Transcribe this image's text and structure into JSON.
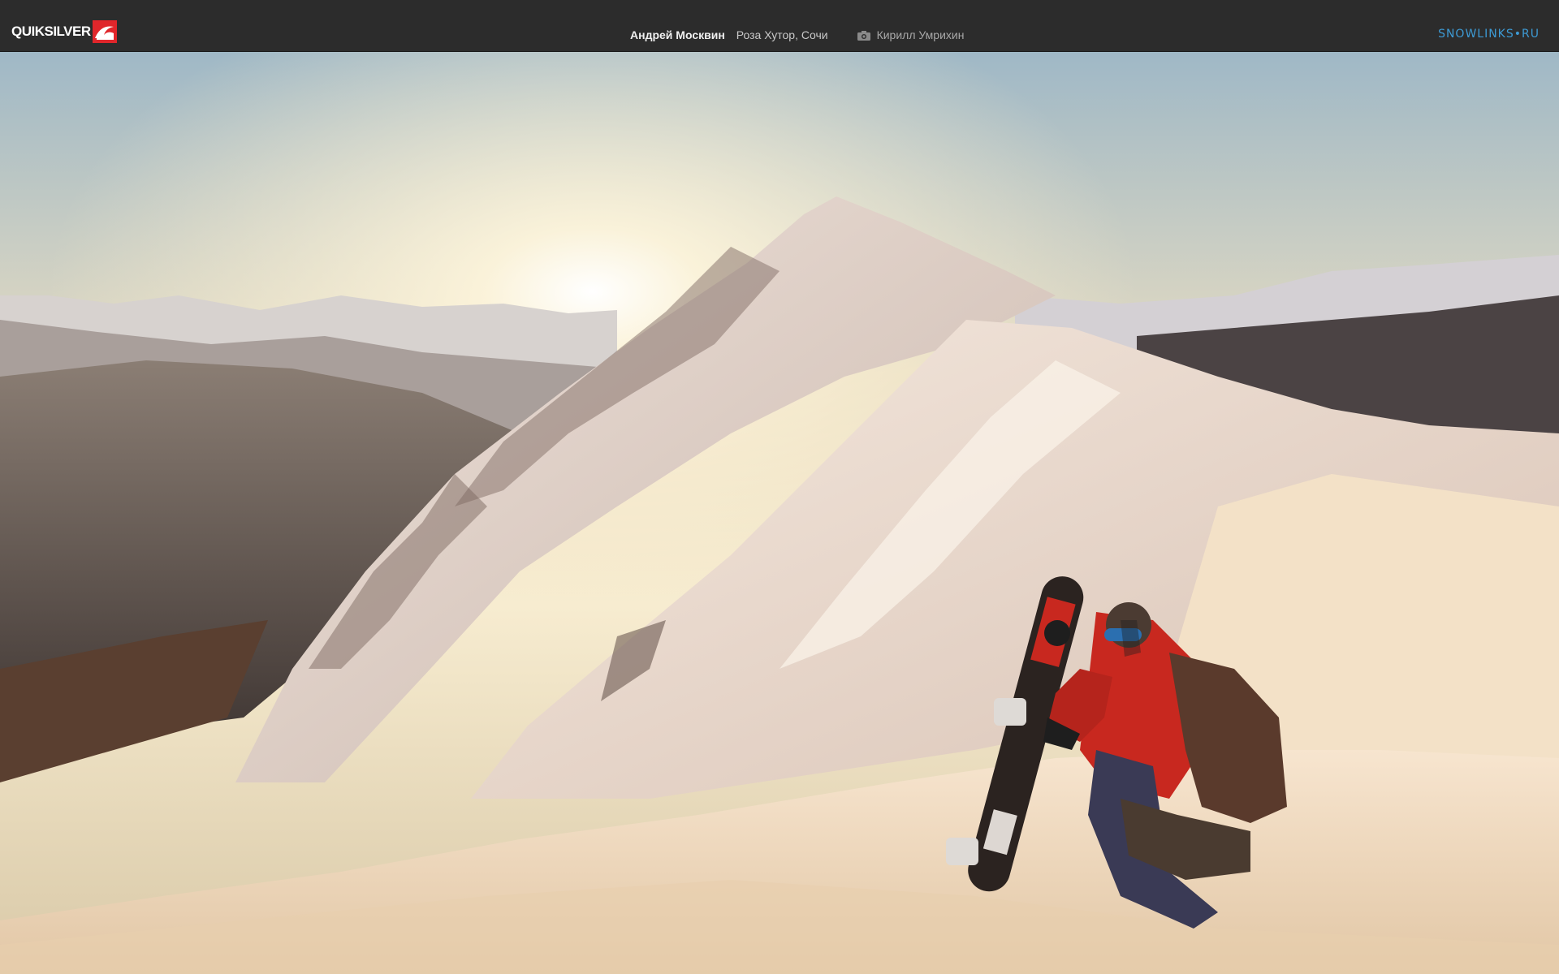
{
  "header": {
    "brand_name": "QUIKSILVER",
    "brand_icon": "quiksilver-wave-logo",
    "athlete": "Андрей Москвин",
    "location": "Роза Хутор, Сочи",
    "camera_icon": "camera-icon",
    "photographer": "Кирилл Умрихин",
    "site": "SNOWLINKS•RU"
  },
  "colors": {
    "bar_bg": "#2c2c2c",
    "brand_red": "#e0262b",
    "site_blue": "#3d9ad4",
    "jacket_red": "#c8281f"
  },
  "photo": {
    "subject": "snowboarder"
  }
}
